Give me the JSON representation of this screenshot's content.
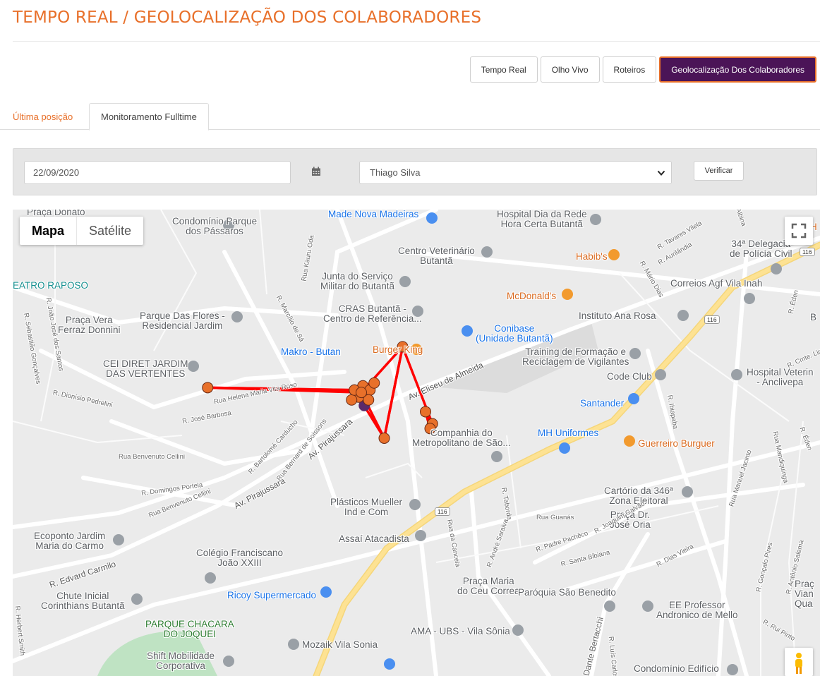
{
  "header": {
    "title": "TEMPO REAL / GEOLOCALIZAÇÃO DOS COLABORADORES"
  },
  "nav_buttons": [
    {
      "label": "Tempo Real",
      "active": false
    },
    {
      "label": "Olho Vivo",
      "active": false
    },
    {
      "label": "Roteiros",
      "active": false
    },
    {
      "label": "Geolocalização Dos Colaboradores",
      "active": true
    }
  ],
  "tabs": {
    "last_position": "Última posição",
    "fulltime": "Monitoramento Fulltime"
  },
  "filters": {
    "date_value": "22/09/2020",
    "calendar_icon": "calendar-icon",
    "employee": "Thiago Silva",
    "verify_label": "Verificar"
  },
  "map": {
    "type_map": "Mapa",
    "type_satellite": "Satélite",
    "route_color": "#ff0000",
    "marker_color": "#e8702a",
    "labels": {
      "praca_donato": "Praça Donato",
      "cond_parque": "Condomínio Parque\ndos Pássaros",
      "teatro": "EATRO RAPOSO",
      "made_nova": "Made Nova Madeiras",
      "hospital_dia": "Hospital Dia da Rede\nHora Certa Butantã",
      "centro_vet": "Centro Veterinário\nButantã",
      "junta": "Junta do Serviço\nMilitar do Butantã",
      "habibs": "Habib's",
      "mcdonalds": "McDonald's",
      "delegacia": "34ª Delegacia\nde Polícia Civil",
      "correios": "Correios Agf Vila Inah",
      "praca_vera": "Praça Vera\nFerraz Donnini",
      "parque_flores": "Parque Das Flores -\nResidencial Jardim",
      "cras": "CRAS Butantã -\nCentro de Referência...",
      "conibase": "Conibase\n(Unidade Butantã)",
      "instituto": "Instituto Ana Rosa",
      "makro": "Makro - Butan",
      "burger_king": "Burger King",
      "training": "Training de Formação e\nReciclagem de Vigilantes",
      "cei": "CEI DIRET JARDIM\nDAS VERTENTES",
      "code_club": "Code Club",
      "hospital_vet": "Hospital Veterin\n- Anclivepa",
      "santander": "Santander",
      "companhia": "Companhia do\nMetropolitano de São...",
      "mh": "MH Uniformes",
      "guerreiro": "Guerreiro Burguer",
      "plasticos": "Plásticos Mueller\nInd e Com",
      "cartorio": "Cartório da 346ª\nZona Eleitoral",
      "praca_oria": "Praça Dr.\nJosé Oria",
      "ecoponto": "Ecoponto Jardim\nMaria do Carmo",
      "colegio": "Colégio Franciscano\nJoão XXIII",
      "assai": "Assaí Atacadista",
      "ricoy": "Ricoy Supermercado",
      "chute": "Chute Inicial\nCorinthians Butantã",
      "praca_maria": "Praça Maria\ndo Ceu Correa",
      "paroquia": "Paróquia São Benedito",
      "ee_prof": "EE Professor\nAndronico de Mello",
      "parque_chacara": "PARQUE CHACARA\nDO JOQUEI",
      "ama": "AMA - UBS - Vila Sônia",
      "mozaik": "Mozaik Vila Sonia",
      "shift": "Shift Mobilidade\nCorporativa",
      "condominio_ed": "Condomínio Edifício",
      "praca_vian": "Praç\nVian\nQua",
      "h_partial": "H",
      "b_partial": "B",
      "av_eliseu": "Av. Eliseu de Almeida",
      "av_pira_1": "Av. Pirajussara",
      "av_pira_2": "Av. Pirajussara",
      "r_edvard": "R. Edvard Carmilo",
      "r_ibiapaba": "R. Ibiapaba",
      "av_manuel": "Rua Manuel Jacinto",
      "r_joaquim": "R. Joaquim Galvão",
      "rua_cancea": "Rua da Cancela",
      "r_tabordo": "R. Taborda",
      "rua_guanas": "Rua Guanás",
      "r_padre": "R. Padre Pachêco",
      "r_santa": "R. Santa Bibiana",
      "r_dias": "R. Dias Vieira",
      "rua_helena": "Rua Helena Maria Vita Roso",
      "r_jose_barbosa": "R. José Barbosa",
      "rua_benvenuto": "Rua Benvenuto Cellini",
      "r_domingos": "R. Domingos Portela",
      "r_dionisio": "R. Dionísio Pedrelini",
      "r_bartolome": "R. Bartolomé Carducho",
      "rua_bernard": "Rua Bernard de Soissons",
      "r_marcilio": "R. Marcílio de Sá",
      "rua_kauru": "Rua Kauru Oda",
      "r_tavares": "R. Tavares Vilela",
      "r_aurilandia": "R. Aurilândia",
      "r_mario_dias": "R. Mário Dias",
      "albina": "Albina",
      "r_eden": "R. Éden",
      "r_cmte": "R. Cmte. Lira",
      "rua_mandiquinga": "Rua Mandiquinga",
      "r_eden2": "R. Éden",
      "r_goncalo": "R. Gonçalo Pires",
      "r_antonio": "R. Antônio Salema",
      "r_rui": "R. Rui Pinto",
      "r_joao_jose": "R. João José dos Santos",
      "r_sebastiao": "R. Sebastião Gonçalves",
      "r_herbert": "R. Herbert Smith",
      "dante": "Dante Bertacchi",
      "luis_carlos": "R. Luís Carlos",
      "r_andre": "R. André Saraiva",
      "shield_116a": "116",
      "shield_116b": "116",
      "shield_116c": "116"
    },
    "route": [
      {
        "lat": -23.5848,
        "lon": -46.7437
      },
      {
        "lat": -23.5849,
        "lon": -46.7373
      },
      {
        "lat": -23.585,
        "lon": -46.737
      },
      {
        "lat": -23.5869,
        "lon": -46.736
      },
      {
        "lat": -23.5831,
        "lon": -46.7352
      },
      {
        "lat": -23.5863,
        "lon": -46.7339
      },
      {
        "lat": -23.5865,
        "lon": -46.734
      },
      {
        "lat": -23.5858,
        "lon": -46.7342
      }
    ]
  }
}
